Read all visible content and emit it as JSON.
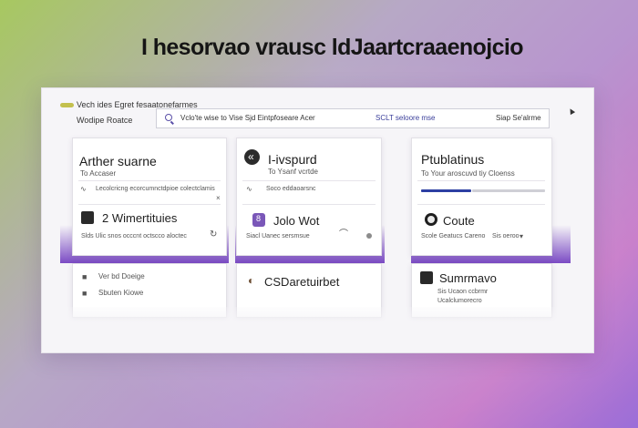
{
  "headline": "I hesorvao vrausc ldJaartcraaenojcio",
  "app": {
    "brand_title": "Vech ides Egret  fesaatonefarmes",
    "brand_sub": "Wodipe Roatce",
    "accent_color": "#7a57b8"
  },
  "search": {
    "text": "Vclo'te wise to Vise Sjd Eintpfoseare Acer",
    "meta": "SCLT seloore mse",
    "right": "Siap Se'alrme"
  },
  "cards": {
    "c1": {
      "title": "Arther suarne",
      "sub": "To  Accaser",
      "row1": "Lecolcricng ecorcumnctdpioe colectclamis",
      "sub_title": "2  Wimertituies",
      "sub_row": "Slds   Ulic snos occcnt octscco aloctec"
    },
    "c2": {
      "title": "I-ivspurd",
      "sub": "To  Ysanf vcrtde",
      "row1": "Soco eddaoarsnc",
      "sub_title": "Jolo Wot",
      "sub_row": "Siacl   Uanec sersmsue"
    },
    "c3": {
      "title": "Ptublatinus",
      "sub": "To  Your aroscuvd tiy Cloenss",
      "row1": "",
      "sub_title": "Coute",
      "sub_row": "Scole Geatucs Careno",
      "sub_row_right": "Sis  oeroo"
    },
    "c4": {
      "row1": "Ver bd Doeige",
      "row2": "Sbuten Kiowe"
    },
    "c5": {
      "title": "CSDaretuirbet"
    },
    "c6": {
      "title": "Sumrmavo",
      "row1": "Sis  Ucaon ccbrmr",
      "row2": "Ucalclumorecro"
    }
  }
}
